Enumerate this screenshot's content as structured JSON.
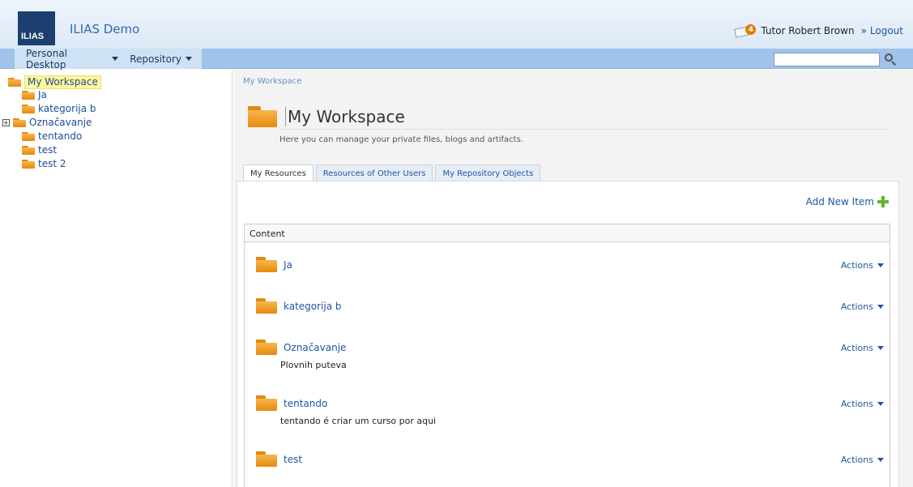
{
  "header": {
    "logo_text": "ILIAS",
    "app_title": "ILIAS Demo",
    "notification_count": "4",
    "user_name": "Tutor Robert Brown",
    "separator": "»",
    "logout_label": "Logout"
  },
  "nav": {
    "personal_desktop": "Personal Desktop",
    "repository": "Repository",
    "search_value": ""
  },
  "tree": {
    "root": "My Workspace",
    "items": [
      "Ja",
      "kategorija b",
      "Označavanje",
      "tentando",
      "test",
      "test 2"
    ]
  },
  "main": {
    "breadcrumb": "My Workspace",
    "title": "My Workspace",
    "description": "Here you can manage your private files, blogs and artifacts.",
    "tabs": [
      "My Resources",
      "Resources of Other Users",
      "My Repository Objects"
    ],
    "add_new_item": "Add New Item",
    "content_header": "Content",
    "actions_label": "Actions",
    "items": [
      {
        "title": "Ja",
        "desc": ""
      },
      {
        "title": "kategorija b",
        "desc": ""
      },
      {
        "title": "Označavanje",
        "desc": "Plovnih puteva"
      },
      {
        "title": "tentando",
        "desc": "tentando é criar um curso por aqui"
      },
      {
        "title": "test",
        "desc": ""
      }
    ]
  },
  "colors": {
    "header_bg": "#dce9f6",
    "navbar_bg": "#9fc3ea",
    "link": "#2255a4",
    "folder": "#f0a030",
    "selected_bg": "#fff79a"
  }
}
